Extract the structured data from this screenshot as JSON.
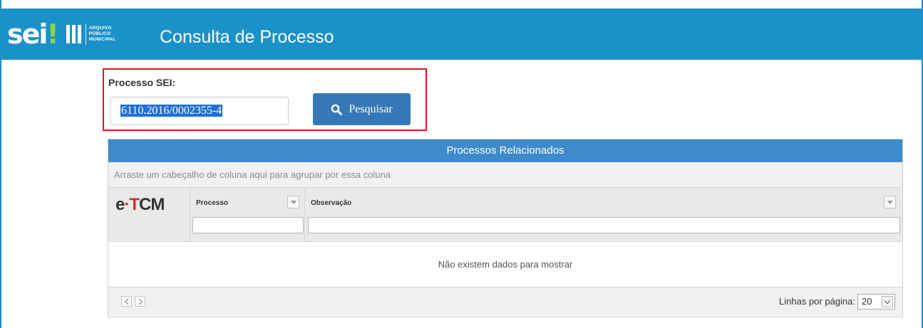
{
  "header": {
    "logo_sei": "sei",
    "logo_sei_dot": "!",
    "logo_text": [
      "ARQUIVO",
      "PÚBLICO",
      "MUNICIPAL"
    ],
    "title": "Consulta de Processo",
    "background_color": "#1a91c9"
  },
  "search": {
    "label": "Processo SEI:",
    "value": "6110.2016/0002355-4",
    "button_label": "Pesquisar",
    "button_icon": "search-icon",
    "highlight_color": "#e3141b"
  },
  "grid": {
    "title": "Processos Relacionados",
    "group_hint": "Arraste um cabeçalho de coluna aqui para agrupar por essa coluna",
    "logo": {
      "prefix": "e",
      "middle": "T",
      "suffix": "CM"
    },
    "columns": [
      {
        "label": "Processo"
      },
      {
        "label": "Observação"
      }
    ],
    "empty_message": "Não existem dados para mostrar",
    "rows_per_page_label": "Linhas por página:",
    "rows_per_page_value": "20",
    "title_color": "#3e8acb"
  }
}
